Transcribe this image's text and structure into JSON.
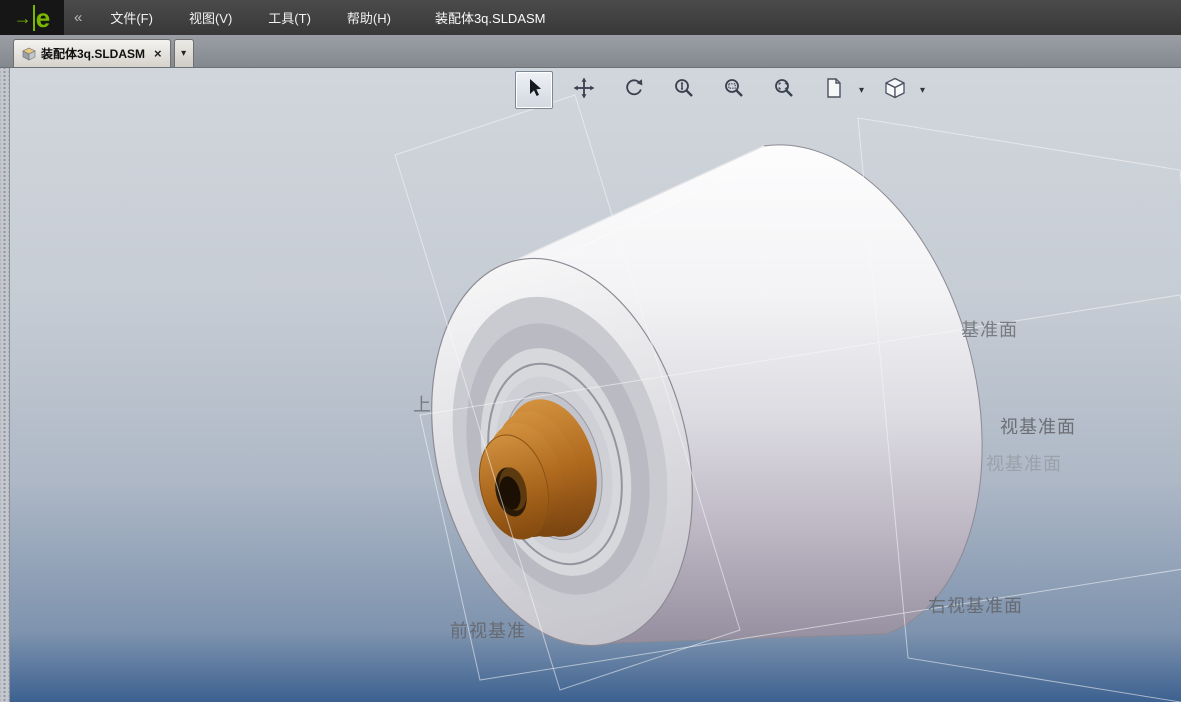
{
  "app": {
    "logo_arrow": "→",
    "logo_letter": "e",
    "collapse_glyph": "«",
    "window_title": "装配体3q.SLDASM"
  },
  "menu": {
    "items": [
      {
        "label": "文件(F)"
      },
      {
        "label": "视图(V)"
      },
      {
        "label": "工具(T)"
      },
      {
        "label": "帮助(H)"
      }
    ]
  },
  "tabbar": {
    "tab_label": "装配体3q.SLDASM",
    "close_glyph": "×",
    "dropdown_glyph": "▾"
  },
  "toolbar": {
    "dropdown_glyph": "▾",
    "buttons": [
      {
        "name": "select",
        "icon": "cursor-arrow-icon",
        "active": true
      },
      {
        "name": "pan",
        "icon": "pan-arrows-icon",
        "active": false
      },
      {
        "name": "rotate",
        "icon": "rotate-arrows-icon",
        "active": false
      },
      {
        "name": "zoom",
        "icon": "zoom-in-out-icon",
        "active": false
      },
      {
        "name": "zoom-area",
        "icon": "zoom-area-icon",
        "active": false
      },
      {
        "name": "zoom-fit",
        "icon": "zoom-fit-icon",
        "active": false
      },
      {
        "name": "markup",
        "icon": "page-stamp-icon",
        "active": false,
        "has_dropdown": true
      },
      {
        "name": "views",
        "icon": "cube-icon",
        "active": false,
        "has_dropdown": true
      }
    ]
  },
  "viewport": {
    "plane_labels": [
      {
        "text": "基准面"
      },
      {
        "text": "视基准面"
      },
      {
        "text": "视基准面"
      },
      {
        "text": "右视基准面"
      },
      {
        "text": "前视基准"
      },
      {
        "text": "上"
      }
    ],
    "colors": {
      "bg_top": "#d1d6dc",
      "bg_bottom": "#3c6190",
      "hub_orange": "#b06a1e",
      "body_shadow": "#958e9f",
      "plane_line": "rgba(248,249,252,0.55)"
    }
  }
}
